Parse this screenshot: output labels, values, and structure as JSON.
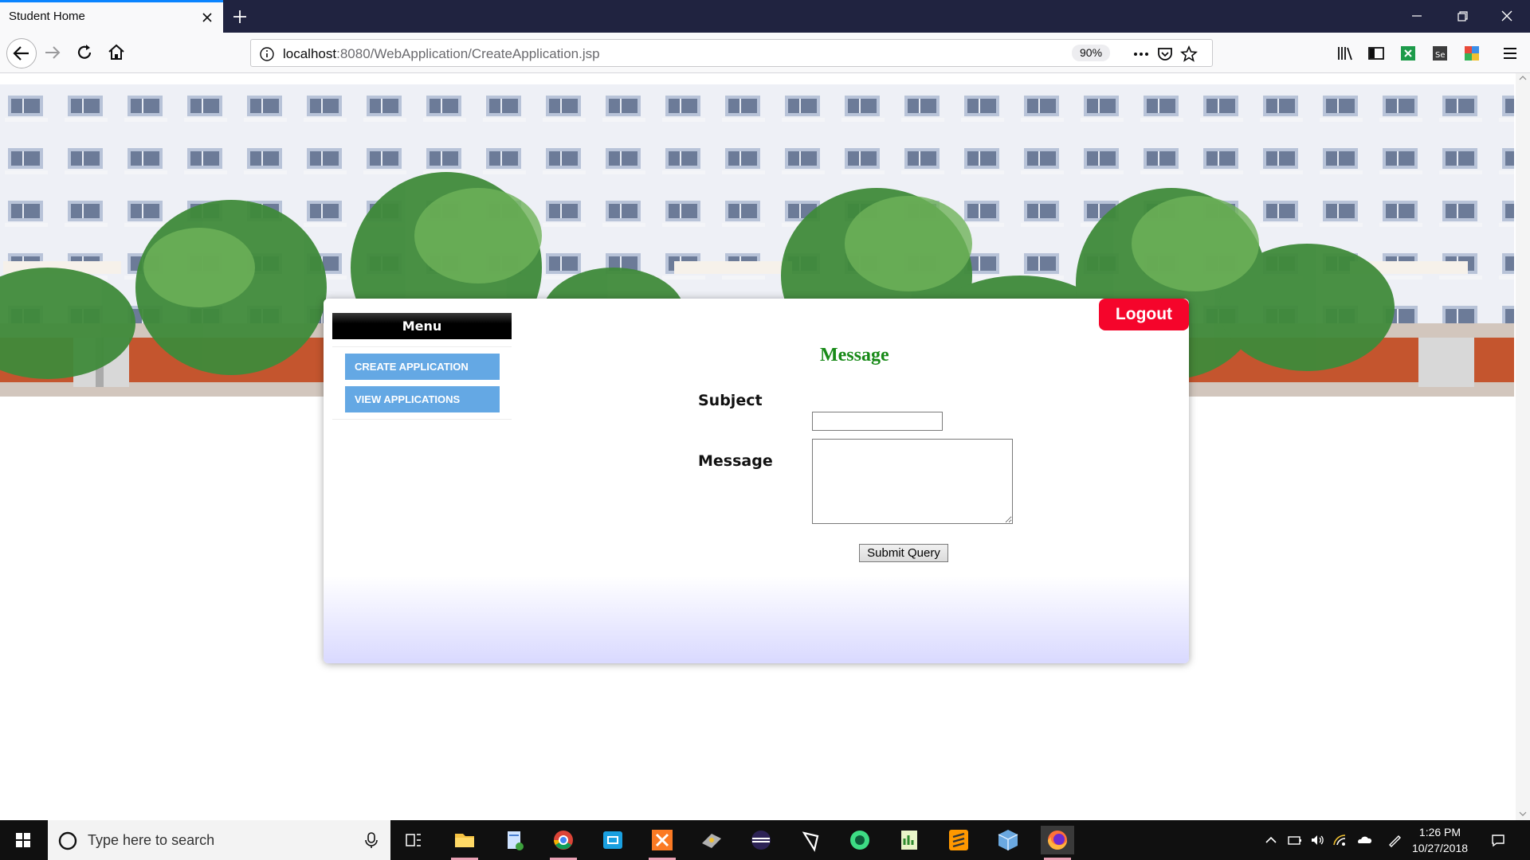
{
  "browser": {
    "tab_title": "Student Home",
    "url_host": "localhost",
    "url_rest": ":8080/WebApplication/CreateApplication.jsp",
    "zoom": "90%"
  },
  "page": {
    "logout_label": "Logout",
    "menu": {
      "heading": "Menu",
      "items": [
        {
          "label": "CREATE APPLICATION"
        },
        {
          "label": "VIEW APPLICATIONS"
        }
      ]
    },
    "form": {
      "title": "Message",
      "subject_label": "Subject",
      "subject_value": "",
      "message_label": "Message",
      "message_value": "",
      "submit_label": "Submit Query"
    },
    "colors": {
      "logout": "#f5052b",
      "menu_item": "#64a8e4",
      "form_title": "#188a18"
    }
  },
  "taskbar": {
    "search_placeholder": "Type here to search",
    "time": "1:26 PM",
    "date": "10/27/2018",
    "apps": [
      "task-view-icon",
      "file-explorer-icon",
      "notepad-app-icon",
      "chrome-icon",
      "remote-app-icon",
      "xampp-icon",
      "dev-app-icon",
      "eclipse-icon",
      "unity-icon",
      "android-studio-icon",
      "data-app-icon",
      "sublime-text-icon",
      "box-app-icon",
      "firefox-icon"
    ]
  }
}
